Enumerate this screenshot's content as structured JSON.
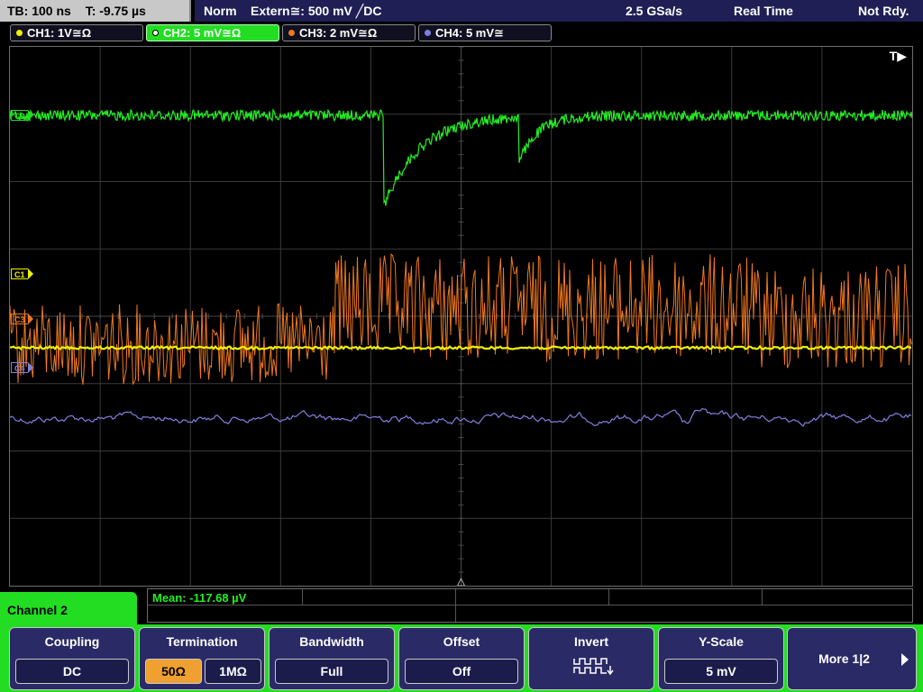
{
  "topbar": {
    "timebase": "TB: 100 ns",
    "trigger_time": "T: -9.75 µs",
    "mode": "Norm",
    "trigger": "Extern≅: 500 mV ╱DC",
    "sample_rate": "2.5 GSa/s",
    "acq_mode": "Real Time",
    "status": "Not Rdy."
  },
  "channels": [
    {
      "label": "CH1: 1V≅Ω",
      "color": "#f0f000"
    },
    {
      "label": "CH2: 5 mV≅Ω",
      "color": "#22dd22"
    },
    {
      "label": "CH3: 2 mV≅Ω",
      "color": "#f07820"
    },
    {
      "label": "CH4: 5 mV≅",
      "color": "#8080e0"
    }
  ],
  "screen": {
    "trigger_marker": "T▶",
    "markers": {
      "c2": "C2",
      "c1": "C1",
      "c3": "C3",
      "c4": "C4"
    }
  },
  "measurement": {
    "label": "Mean: -117.68 µV"
  },
  "menu": {
    "title": "Channel 2",
    "coupling": {
      "label": "Coupling",
      "value": "DC"
    },
    "termination": {
      "label": "Termination",
      "opt1": "50Ω",
      "opt2": "1MΩ"
    },
    "bandwidth": {
      "label": "Bandwidth",
      "value": "Full"
    },
    "offset": {
      "label": "Offset",
      "value": "Off"
    },
    "invert": {
      "label": "Invert"
    },
    "yscale": {
      "label": "Y-Scale",
      "value": "5 mV"
    },
    "more": "More 1|2"
  }
}
